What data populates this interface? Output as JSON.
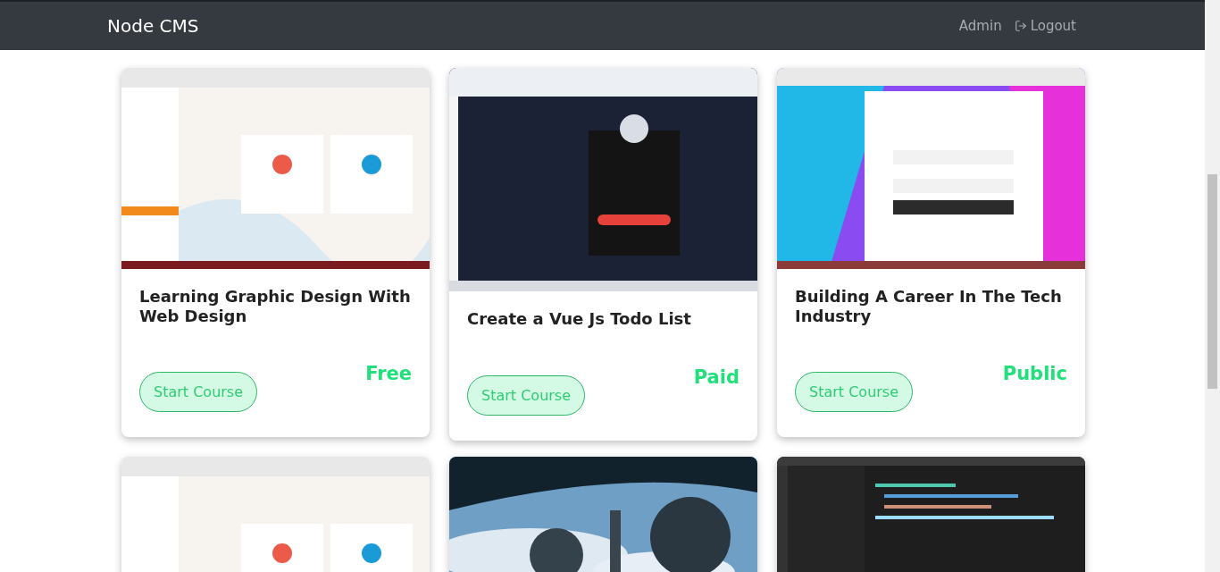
{
  "navbar": {
    "brand": "Node CMS",
    "links": [
      {
        "label": "Admin"
      },
      {
        "label": "Logout"
      }
    ]
  },
  "courses": [
    {
      "image": {
        "kind": "picture"
      },
      "title": "Learning Graphic Design With Web Design",
      "button": "Start Course",
      "price": "Free"
    },
    {
      "image": {
        "kind": "picture"
      },
      "title": "Create a Vue Js Todo List",
      "button": "Start Course",
      "price": "Paid"
    },
    {
      "image": {
        "kind": "picture"
      },
      "title": "Building A Career In The Tech Industry",
      "button": "Start Course",
      "price": "Public"
    },
    {
      "image": {
        "kind": "picture"
      }
    },
    {
      "image": {
        "kind": "picture"
      }
    },
    {
      "image": {
        "kind": "picture"
      }
    }
  ]
}
